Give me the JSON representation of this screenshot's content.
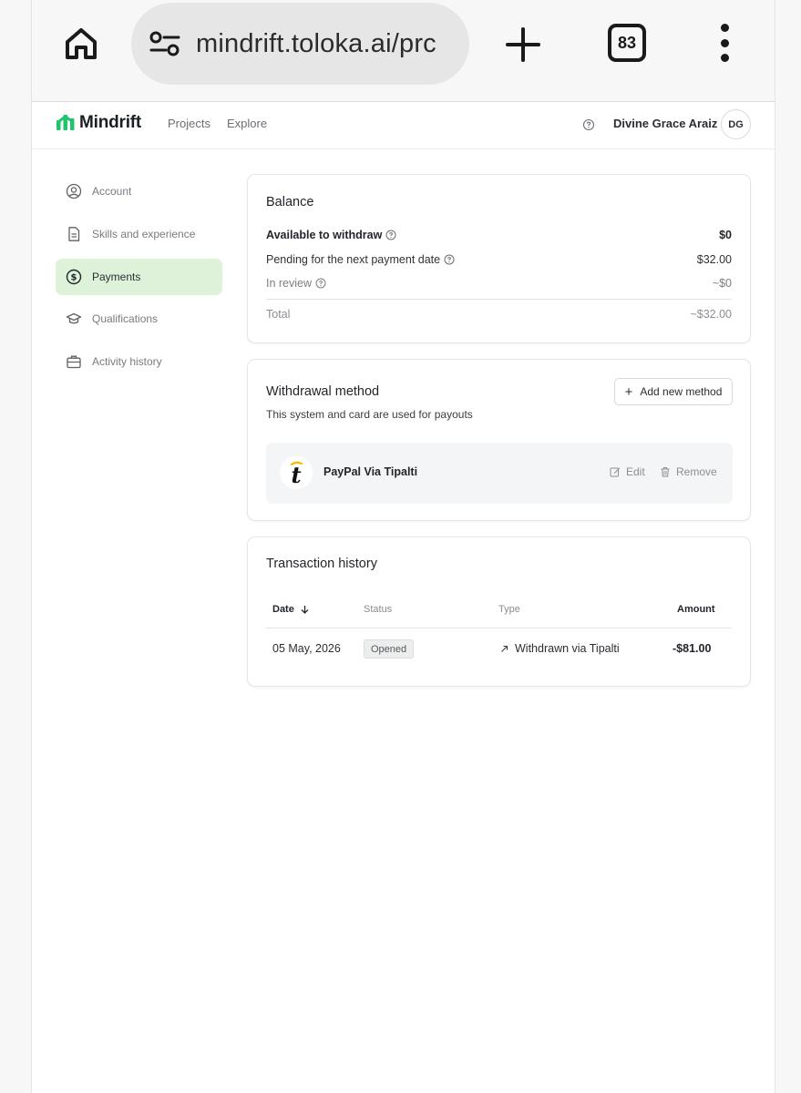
{
  "browser": {
    "url": "mindrift.toloka.ai/prc",
    "tab_count": "83"
  },
  "header": {
    "logo_text": "Mindrift",
    "nav": [
      "Projects",
      "Explore"
    ],
    "user_name": "Divine Grace Araiz",
    "avatar_initials": "DG"
  },
  "sidebar": {
    "items": [
      {
        "label": "Account",
        "icon": "user-circle-icon",
        "active": false
      },
      {
        "label": "Skills and experience",
        "icon": "document-icon",
        "active": false
      },
      {
        "label": "Payments",
        "icon": "dollar-circle-icon",
        "active": true
      },
      {
        "label": "Qualifications",
        "icon": "graduation-cap-icon",
        "active": false
      },
      {
        "label": "Activity history",
        "icon": "briefcase-icon",
        "active": false
      }
    ]
  },
  "balance": {
    "title": "Balance",
    "available_label": "Available to withdraw",
    "available_value": "$0",
    "pending_label": "Pending for the next payment date",
    "pending_value": "$32.00",
    "review_label": "In review",
    "review_value": "~$0",
    "total_label": "Total",
    "total_value": "~$32.00"
  },
  "withdrawal": {
    "title": "Withdrawal method",
    "subtitle": "This system and card are used for payouts",
    "add_button": "Add new method",
    "method_name": "PayPal Via Tipalti",
    "edit_label": "Edit",
    "remove_label": "Remove"
  },
  "transactions": {
    "title": "Transaction history",
    "columns": [
      "Date",
      "Status",
      "Type",
      "Amount"
    ],
    "rows": [
      {
        "date": "05 May, 2026",
        "status": "Opened",
        "type": "Withdrawn via Tipalti",
        "amount": "-$81.00"
      }
    ]
  },
  "colors": {
    "brand_green": "#1fc46b",
    "active_bg": "#def2d9"
  }
}
